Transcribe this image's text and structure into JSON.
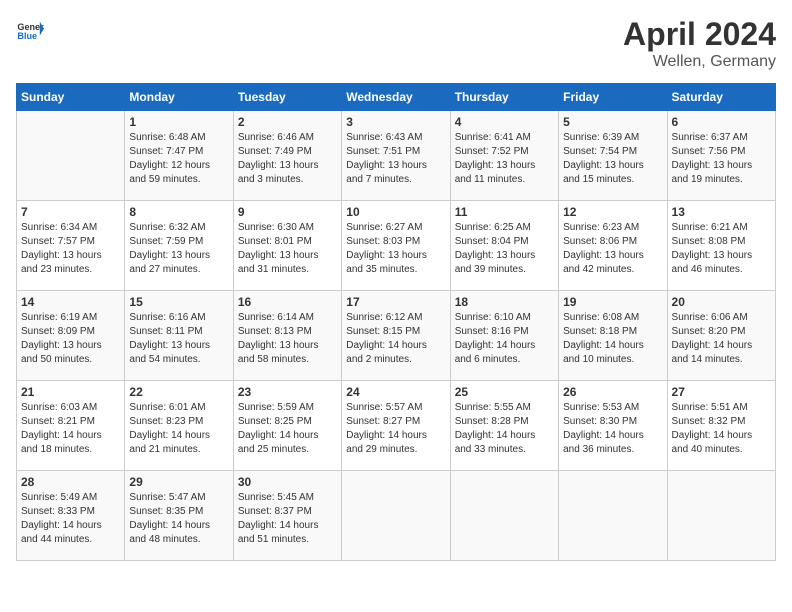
{
  "header": {
    "logo_general": "General",
    "logo_blue": "Blue",
    "month": "April 2024",
    "location": "Wellen, Germany"
  },
  "days_of_week": [
    "Sunday",
    "Monday",
    "Tuesday",
    "Wednesday",
    "Thursday",
    "Friday",
    "Saturday"
  ],
  "weeks": [
    [
      {
        "day": "",
        "info": ""
      },
      {
        "day": "1",
        "info": "Sunrise: 6:48 AM\nSunset: 7:47 PM\nDaylight: 12 hours\nand 59 minutes."
      },
      {
        "day": "2",
        "info": "Sunrise: 6:46 AM\nSunset: 7:49 PM\nDaylight: 13 hours\nand 3 minutes."
      },
      {
        "day": "3",
        "info": "Sunrise: 6:43 AM\nSunset: 7:51 PM\nDaylight: 13 hours\nand 7 minutes."
      },
      {
        "day": "4",
        "info": "Sunrise: 6:41 AM\nSunset: 7:52 PM\nDaylight: 13 hours\nand 11 minutes."
      },
      {
        "day": "5",
        "info": "Sunrise: 6:39 AM\nSunset: 7:54 PM\nDaylight: 13 hours\nand 15 minutes."
      },
      {
        "day": "6",
        "info": "Sunrise: 6:37 AM\nSunset: 7:56 PM\nDaylight: 13 hours\nand 19 minutes."
      }
    ],
    [
      {
        "day": "7",
        "info": "Sunrise: 6:34 AM\nSunset: 7:57 PM\nDaylight: 13 hours\nand 23 minutes."
      },
      {
        "day": "8",
        "info": "Sunrise: 6:32 AM\nSunset: 7:59 PM\nDaylight: 13 hours\nand 27 minutes."
      },
      {
        "day": "9",
        "info": "Sunrise: 6:30 AM\nSunset: 8:01 PM\nDaylight: 13 hours\nand 31 minutes."
      },
      {
        "day": "10",
        "info": "Sunrise: 6:27 AM\nSunset: 8:03 PM\nDaylight: 13 hours\nand 35 minutes."
      },
      {
        "day": "11",
        "info": "Sunrise: 6:25 AM\nSunset: 8:04 PM\nDaylight: 13 hours\nand 39 minutes."
      },
      {
        "day": "12",
        "info": "Sunrise: 6:23 AM\nSunset: 8:06 PM\nDaylight: 13 hours\nand 42 minutes."
      },
      {
        "day": "13",
        "info": "Sunrise: 6:21 AM\nSunset: 8:08 PM\nDaylight: 13 hours\nand 46 minutes."
      }
    ],
    [
      {
        "day": "14",
        "info": "Sunrise: 6:19 AM\nSunset: 8:09 PM\nDaylight: 13 hours\nand 50 minutes."
      },
      {
        "day": "15",
        "info": "Sunrise: 6:16 AM\nSunset: 8:11 PM\nDaylight: 13 hours\nand 54 minutes."
      },
      {
        "day": "16",
        "info": "Sunrise: 6:14 AM\nSunset: 8:13 PM\nDaylight: 13 hours\nand 58 minutes."
      },
      {
        "day": "17",
        "info": "Sunrise: 6:12 AM\nSunset: 8:15 PM\nDaylight: 14 hours\nand 2 minutes."
      },
      {
        "day": "18",
        "info": "Sunrise: 6:10 AM\nSunset: 8:16 PM\nDaylight: 14 hours\nand 6 minutes."
      },
      {
        "day": "19",
        "info": "Sunrise: 6:08 AM\nSunset: 8:18 PM\nDaylight: 14 hours\nand 10 minutes."
      },
      {
        "day": "20",
        "info": "Sunrise: 6:06 AM\nSunset: 8:20 PM\nDaylight: 14 hours\nand 14 minutes."
      }
    ],
    [
      {
        "day": "21",
        "info": "Sunrise: 6:03 AM\nSunset: 8:21 PM\nDaylight: 14 hours\nand 18 minutes."
      },
      {
        "day": "22",
        "info": "Sunrise: 6:01 AM\nSunset: 8:23 PM\nDaylight: 14 hours\nand 21 minutes."
      },
      {
        "day": "23",
        "info": "Sunrise: 5:59 AM\nSunset: 8:25 PM\nDaylight: 14 hours\nand 25 minutes."
      },
      {
        "day": "24",
        "info": "Sunrise: 5:57 AM\nSunset: 8:27 PM\nDaylight: 14 hours\nand 29 minutes."
      },
      {
        "day": "25",
        "info": "Sunrise: 5:55 AM\nSunset: 8:28 PM\nDaylight: 14 hours\nand 33 minutes."
      },
      {
        "day": "26",
        "info": "Sunrise: 5:53 AM\nSunset: 8:30 PM\nDaylight: 14 hours\nand 36 minutes."
      },
      {
        "day": "27",
        "info": "Sunrise: 5:51 AM\nSunset: 8:32 PM\nDaylight: 14 hours\nand 40 minutes."
      }
    ],
    [
      {
        "day": "28",
        "info": "Sunrise: 5:49 AM\nSunset: 8:33 PM\nDaylight: 14 hours\nand 44 minutes."
      },
      {
        "day": "29",
        "info": "Sunrise: 5:47 AM\nSunset: 8:35 PM\nDaylight: 14 hours\nand 48 minutes."
      },
      {
        "day": "30",
        "info": "Sunrise: 5:45 AM\nSunset: 8:37 PM\nDaylight: 14 hours\nand 51 minutes."
      },
      {
        "day": "",
        "info": ""
      },
      {
        "day": "",
        "info": ""
      },
      {
        "day": "",
        "info": ""
      },
      {
        "day": "",
        "info": ""
      }
    ]
  ]
}
